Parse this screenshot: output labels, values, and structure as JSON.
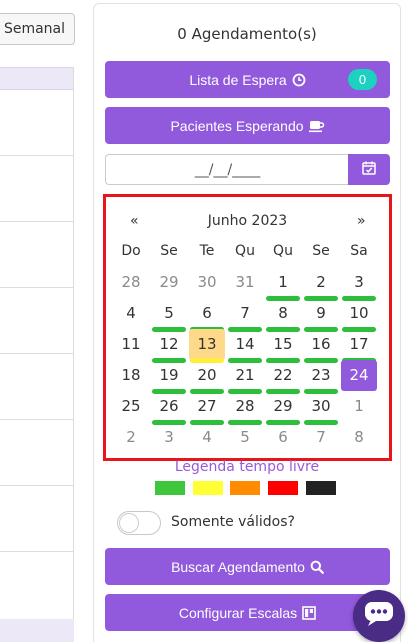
{
  "left": {
    "view_button": "Semanal"
  },
  "panel": {
    "appointment_count": "0 Agendamento(s)",
    "waitlist": {
      "label": "Lista de Espera",
      "badge": "0",
      "icon": "clock-icon"
    },
    "waiting_patients": {
      "label": "Pacientes Esperando",
      "icon": "coffee-cup-icon"
    },
    "date_input": {
      "value": "__/__/____"
    },
    "search_button": {
      "label": "Buscar Agendamento",
      "icon": "search-icon"
    },
    "config_button": {
      "label": "Configurar Escalas",
      "icon": "layout-icon"
    }
  },
  "calendar": {
    "prev": "«",
    "next": "»",
    "title": "Junho 2023",
    "weekdays": [
      "Do",
      "Se",
      "Te",
      "Qu",
      "Qu",
      "Se",
      "Sa"
    ],
    "weeks": [
      [
        {
          "d": "28",
          "m": false,
          "bar": false
        },
        {
          "d": "29",
          "m": false,
          "bar": false
        },
        {
          "d": "30",
          "m": false,
          "bar": false
        },
        {
          "d": "31",
          "m": false,
          "bar": false
        },
        {
          "d": "1",
          "m": true,
          "bar": true
        },
        {
          "d": "2",
          "m": true,
          "bar": true
        },
        {
          "d": "3",
          "m": true,
          "bar": true
        }
      ],
      [
        {
          "d": "4",
          "m": true,
          "bar": false
        },
        {
          "d": "5",
          "m": true,
          "bar": true
        },
        {
          "d": "6",
          "m": true,
          "bar": true
        },
        {
          "d": "7",
          "m": true,
          "bar": true
        },
        {
          "d": "8",
          "m": true,
          "bar": true
        },
        {
          "d": "9",
          "m": true,
          "bar": true
        },
        {
          "d": "10",
          "m": true,
          "bar": true
        }
      ],
      [
        {
          "d": "11",
          "m": true,
          "bar": false
        },
        {
          "d": "12",
          "m": true,
          "bar": true
        },
        {
          "d": "13",
          "m": true,
          "bar": true,
          "today": true
        },
        {
          "d": "14",
          "m": true,
          "bar": true
        },
        {
          "d": "15",
          "m": true,
          "bar": true
        },
        {
          "d": "16",
          "m": true,
          "bar": true
        },
        {
          "d": "17",
          "m": true,
          "bar": true
        }
      ],
      [
        {
          "d": "18",
          "m": true,
          "bar": false
        },
        {
          "d": "19",
          "m": true,
          "bar": true
        },
        {
          "d": "20",
          "m": true,
          "bar": true
        },
        {
          "d": "21",
          "m": true,
          "bar": true
        },
        {
          "d": "22",
          "m": true,
          "bar": true
        },
        {
          "d": "23",
          "m": true,
          "bar": true
        },
        {
          "d": "24",
          "m": true,
          "bar": false,
          "selected": true
        }
      ],
      [
        {
          "d": "25",
          "m": true,
          "bar": false
        },
        {
          "d": "26",
          "m": true,
          "bar": true
        },
        {
          "d": "27",
          "m": true,
          "bar": true
        },
        {
          "d": "28",
          "m": true,
          "bar": true
        },
        {
          "d": "29",
          "m": true,
          "bar": true
        },
        {
          "d": "30",
          "m": true,
          "bar": true
        },
        {
          "d": "1",
          "m": false,
          "bar": false
        }
      ],
      [
        {
          "d": "2",
          "m": false,
          "bar": false
        },
        {
          "d": "3",
          "m": false,
          "bar": false
        },
        {
          "d": "4",
          "m": false,
          "bar": false
        },
        {
          "d": "5",
          "m": false,
          "bar": false
        },
        {
          "d": "6",
          "m": false,
          "bar": false
        },
        {
          "d": "7",
          "m": false,
          "bar": false
        },
        {
          "d": "8",
          "m": false,
          "bar": false
        }
      ]
    ]
  },
  "legend": {
    "title": "Legenda tempo livre",
    "colors": [
      "#3ec73c",
      "#ffff33",
      "#ff8c00",
      "#ff0000",
      "#222222"
    ]
  },
  "toggle": {
    "label": "Somente válidos?",
    "checked": false
  },
  "colors": {
    "accent": "#9159dc",
    "badge": "#1dd1c0",
    "highlight_border": "#e8151b"
  }
}
